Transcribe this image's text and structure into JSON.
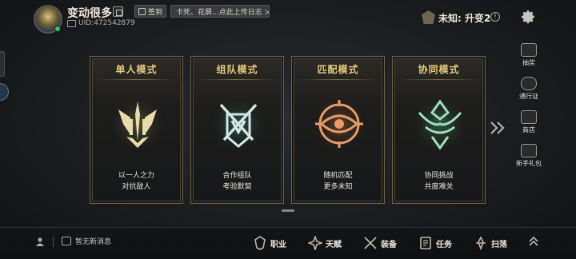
{
  "profile": {
    "username": "变动很多",
    "uid": "UID:472542879",
    "signin_label": "签到",
    "log_text": "卡死、花屏...点此上传日志 >"
  },
  "status": {
    "rank_text": "未知: 升变2",
    "info_glyph": "!"
  },
  "modes": [
    {
      "title": "单人模式",
      "line1": "以一人之力",
      "line2": "对抗敌人",
      "emblem_color": "#e8dcaa"
    },
    {
      "title": "组队模式",
      "line1": "合作组队",
      "line2": "考验默契",
      "emblem_color": "#cfe8e0"
    },
    {
      "title": "匹配模式",
      "line1": "随机匹配",
      "line2": "更多未知",
      "emblem_color": "#e89a62"
    },
    {
      "title": "协同模式",
      "line1": "协同挑战",
      "line2": "共度难关",
      "emblem_color": "#9ee0b8"
    }
  ],
  "side_menu": [
    {
      "label": "抽奖",
      "icon": "lottery-icon"
    },
    {
      "label": "通行证",
      "icon": "pass-icon"
    },
    {
      "label": "商店",
      "icon": "shop-icon"
    },
    {
      "label": "新手礼包",
      "icon": "gift-icon"
    }
  ],
  "chat": {
    "text": "暂无新消息"
  },
  "bottom_nav": [
    {
      "label": "职业",
      "icon": "class-icon"
    },
    {
      "label": "天赋",
      "icon": "talent-icon"
    },
    {
      "label": "装备",
      "icon": "equipment-icon"
    },
    {
      "label": "任务",
      "icon": "quest-icon"
    },
    {
      "label": "扫荡",
      "icon": "sweep-icon"
    }
  ],
  "colors": {
    "title_gold": "#e6c87a",
    "card_border": "#6a6248",
    "online_green": "#3ec45a"
  }
}
